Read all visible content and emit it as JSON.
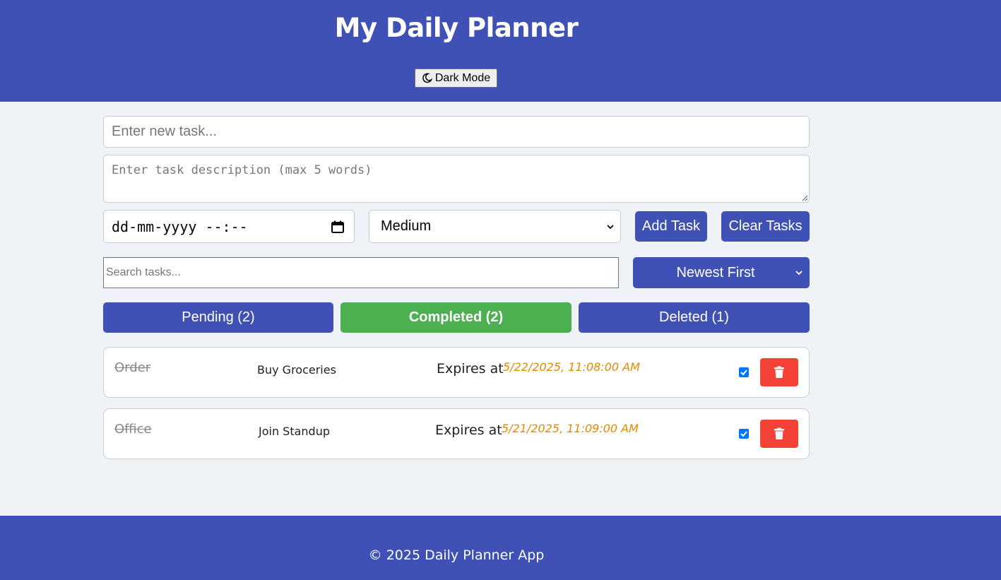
{
  "header": {
    "title": "My Daily Planner",
    "dark_mode_label": "Dark Mode"
  },
  "form": {
    "task_placeholder": "Enter new task...",
    "description_placeholder": "Enter task description (max 5 words)",
    "datetime_placeholder": "dd-mm-yyyy --:--",
    "priority_selected": "Medium",
    "add_button": "Add Task",
    "clear_button": "Clear Tasks"
  },
  "filters": {
    "search_placeholder": "Search tasks...",
    "sort_selected": "Newest First"
  },
  "tabs": [
    {
      "label": "Pending (2)"
    },
    {
      "label": "Completed (2)"
    },
    {
      "label": "Deleted (1)"
    }
  ],
  "tasks": [
    {
      "title": "Order",
      "description": "Buy Groceries",
      "expires_label": "Expires at",
      "expires": "5/22/2025, 11:08:00 AM",
      "completed": true
    },
    {
      "title": "Office",
      "description": "Join Standup",
      "expires_label": "Expires at",
      "expires": "5/21/2025, 11:09:00 AM",
      "completed": true
    }
  ],
  "footer": {
    "text": "© 2025 Daily Planner App"
  },
  "colors": {
    "primary": "#3f51b5",
    "success": "#4caf50",
    "danger": "#f44336",
    "date_accent": "#e68a00",
    "background": "#eff2f7"
  }
}
